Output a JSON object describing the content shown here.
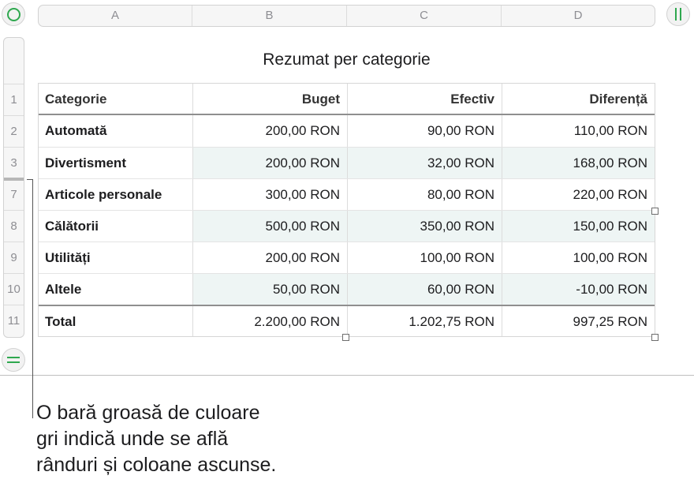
{
  "columns": [
    "A",
    "B",
    "C",
    "D"
  ],
  "table": {
    "title": "Rezumat per categorie",
    "header": {
      "row_number": "1",
      "cells": [
        "Categorie",
        "Buget",
        "Efectiv",
        "Diferență"
      ]
    },
    "rows": [
      {
        "row_number": "2",
        "cells": [
          "Automată",
          "200,00 RON",
          "90,00 RON",
          "110,00 RON"
        ]
      },
      {
        "row_number": "3",
        "cells": [
          "Divertisment",
          "200,00 RON",
          "32,00 RON",
          "168,00 RON"
        ]
      },
      {
        "row_number": "7",
        "cells": [
          "Articole personale",
          "300,00 RON",
          "80,00 RON",
          "220,00 RON"
        ]
      },
      {
        "row_number": "8",
        "cells": [
          "Călătorii",
          "500,00 RON",
          "350,00 RON",
          "150,00 RON"
        ]
      },
      {
        "row_number": "9",
        "cells": [
          "Utilități",
          "200,00 RON",
          "100,00 RON",
          "100,00 RON"
        ]
      },
      {
        "row_number": "10",
        "cells": [
          "Altele",
          "50,00 RON",
          "60,00 RON",
          "-10,00 RON"
        ]
      }
    ],
    "footer": {
      "row_number": "11",
      "cells": [
        "Total",
        "2.200,00 RON",
        "1.202,75 RON",
        "997,25 RON"
      ]
    }
  },
  "callout": {
    "lines": [
      "O bară groasă de culoare",
      "gri indică unde se află",
      "rânduri și coloane ascunse."
    ]
  },
  "colors": {
    "accent": "#2fa84f",
    "alt_row": "#eef5f4",
    "hidden_marker": "#b7b7b7"
  },
  "icons": {
    "select_all": "circle-icon",
    "column_handle": "double-bar-icon",
    "row_handle": "equals-icon"
  }
}
